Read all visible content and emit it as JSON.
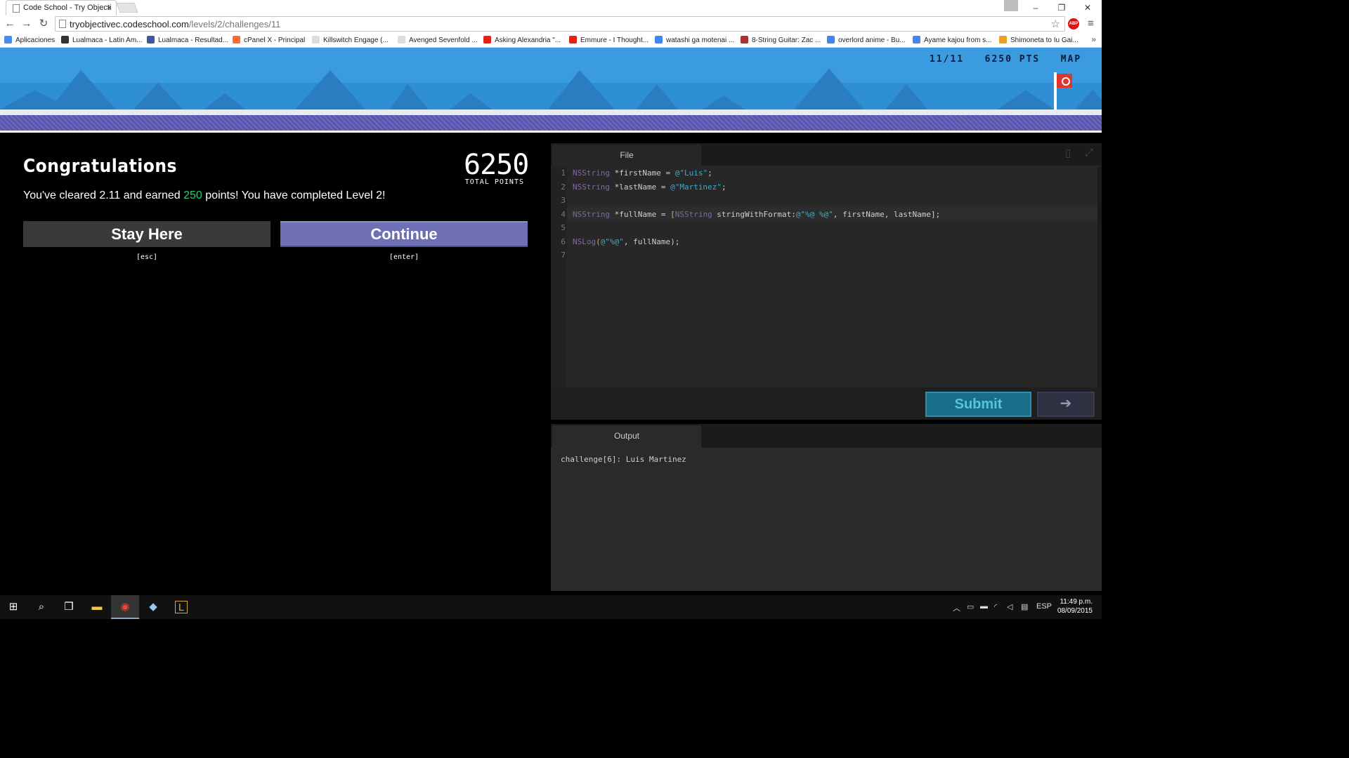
{
  "browser": {
    "tab_title": "Code School - Try Objecti",
    "tab_close": "×",
    "url_host": "tryobjectivec.codeschool.com",
    "url_path": "/levels/2/challenges/11",
    "win_min": "–",
    "win_restore": "❐",
    "win_close": "✕",
    "back": "←",
    "forward": "→",
    "reload": "↻",
    "star": "☆",
    "abp": "ABP",
    "menu": "≡",
    "bookmarks_more": "»",
    "bookmarks": [
      {
        "label": "Aplicaciones",
        "color": "#4a8af4"
      },
      {
        "label": "Lualmaca - Latin Am...",
        "color": "#333333"
      },
      {
        "label": "Lualmaca - Resultad...",
        "color": "#3b5aa0"
      },
      {
        "label": "cPanel X - Principal",
        "color": "#ff6c2c"
      },
      {
        "label": "Killswitch Engage (...",
        "color": "#dddddd"
      },
      {
        "label": "Avenged Sevenfold ...",
        "color": "#dddddd"
      },
      {
        "label": "Asking Alexandria \"...",
        "color": "#e62117"
      },
      {
        "label": "Emmure - I Thought...",
        "color": "#e62117"
      },
      {
        "label": "watashi ga motenai ...",
        "color": "#4285f4"
      },
      {
        "label": "8-String Guitar: Zac ...",
        "color": "#b03030"
      },
      {
        "label": "overlord anime - Bu...",
        "color": "#4285f4"
      },
      {
        "label": "Ayame kajou from s...",
        "color": "#4285f4"
      },
      {
        "label": "Shimoneta to Iu Gai...",
        "color": "#f0a020"
      }
    ]
  },
  "game": {
    "progress": "11/11",
    "points": "6250 PTS",
    "map_label": "MAP"
  },
  "congrats": {
    "title": "Congratulations",
    "total_number": "6250",
    "total_label": "TOTAL POINTS",
    "msg_prefix": "You've cleared 2.11 and earned ",
    "msg_points": "250",
    "msg_suffix": " points! You have completed Level 2!",
    "stay_label": "Stay Here",
    "continue_label": "Continue",
    "stay_hint": "[esc]",
    "continue_hint": "[enter]"
  },
  "editor": {
    "tab_label": "File",
    "line_numbers": [
      "1",
      "2",
      "3",
      "4",
      "5",
      "6",
      "7"
    ],
    "submit_label": "Submit",
    "next_label": "➔",
    "layout_icon": "▯",
    "fullscreen_icon": "⤢",
    "tokens": {
      "l1": [
        "NSString",
        " *firstName = ",
        "@\"Luis\"",
        ";"
      ],
      "l2": [
        "NSString",
        " *lastName = ",
        "@\"Martinez\"",
        ";"
      ],
      "l4": [
        "NSString",
        " *fullName = ",
        "[",
        "NSString",
        " stringWithFormat:",
        "@\"%@ %@\"",
        ", firstName, lastName];"
      ],
      "l6": [
        "NSLog",
        "(",
        "@\"%@\"",
        ", fullName);"
      ]
    }
  },
  "output": {
    "tab_label": "Output",
    "text": "challenge[6]: Luis Martinez"
  },
  "taskbar": {
    "start": "⊞",
    "search": "⌕",
    "taskview": "❒",
    "explorer": "▬",
    "chrome": "◉",
    "app1": "◆",
    "app2": "L",
    "tray_chevron": "︿",
    "lang": "ESP",
    "time": "11:49 p.m.",
    "date": "08/09/2015"
  }
}
